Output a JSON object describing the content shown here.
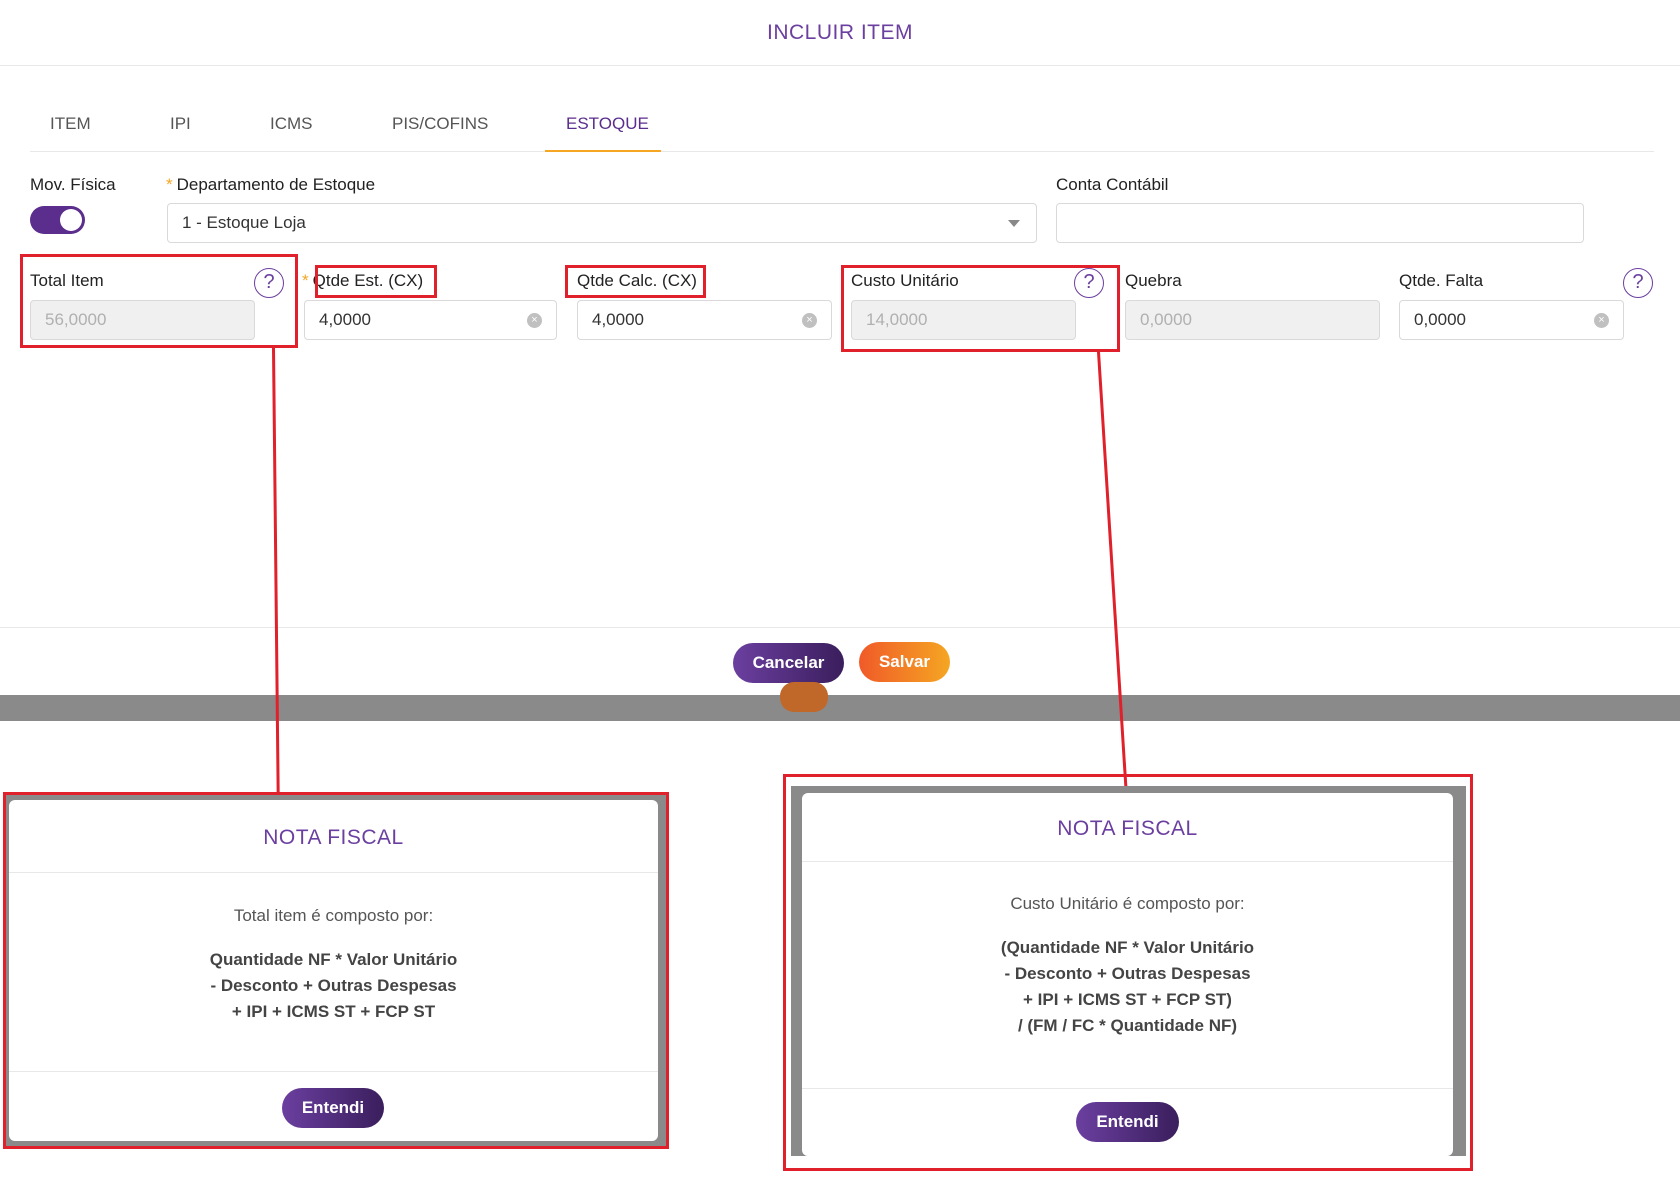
{
  "modal": {
    "title": "INCLUIR ITEM",
    "tabs": [
      {
        "label": "ITEM"
      },
      {
        "label": "IPI"
      },
      {
        "label": "ICMS"
      },
      {
        "label": "PIS/COFINS"
      },
      {
        "label": "ESTOQUE",
        "active": true
      }
    ],
    "fields": {
      "mov_fisica_label": "Mov. Física",
      "mov_fisica_on": true,
      "departamento_label": "Departamento de Estoque",
      "departamento_value": "1 - Estoque Loja",
      "conta_contabil_label": "Conta Contábil",
      "conta_contabil_value": "",
      "total_item_label": "Total Item",
      "total_item_value": "56,0000",
      "qtde_est_label": "Qtde Est. (CX)",
      "qtde_est_value": "4,0000",
      "qtde_calc_label": "Qtde Calc. (CX)",
      "qtde_calc_value": "4,0000",
      "custo_unitario_label": "Custo Unitário",
      "custo_unitario_value": "14,0000",
      "quebra_label": "Quebra",
      "quebra_value": "0,0000",
      "qtde_falta_label": "Qtde. Falta",
      "qtde_falta_value": "0,0000"
    },
    "buttons": {
      "cancel": "Cancelar",
      "save": "Salvar"
    }
  },
  "popup_left": {
    "title": "NOTA FISCAL",
    "intro": "Total item é composto por:",
    "formula": [
      "Quantidade NF * Valor Unitário",
      "- Desconto + Outras Despesas",
      "+ IPI + ICMS ST + FCP ST"
    ],
    "button": "Entendi"
  },
  "popup_right": {
    "title": "NOTA FISCAL",
    "intro": "Custo Unitário é composto por:",
    "formula": [
      "(Quantidade NF * Valor Unitário",
      "- Desconto + Outras Despesas",
      "+ IPI + ICMS ST + FCP ST)",
      "/ (FM / FC * Quantidade NF)"
    ],
    "button": "Entendi"
  },
  "icons": {
    "help": "?",
    "clear": "×"
  },
  "colors": {
    "brand_purple": "#6b3fa0",
    "accent_orange": "#f5a623",
    "annotation_red": "#e0202a"
  }
}
